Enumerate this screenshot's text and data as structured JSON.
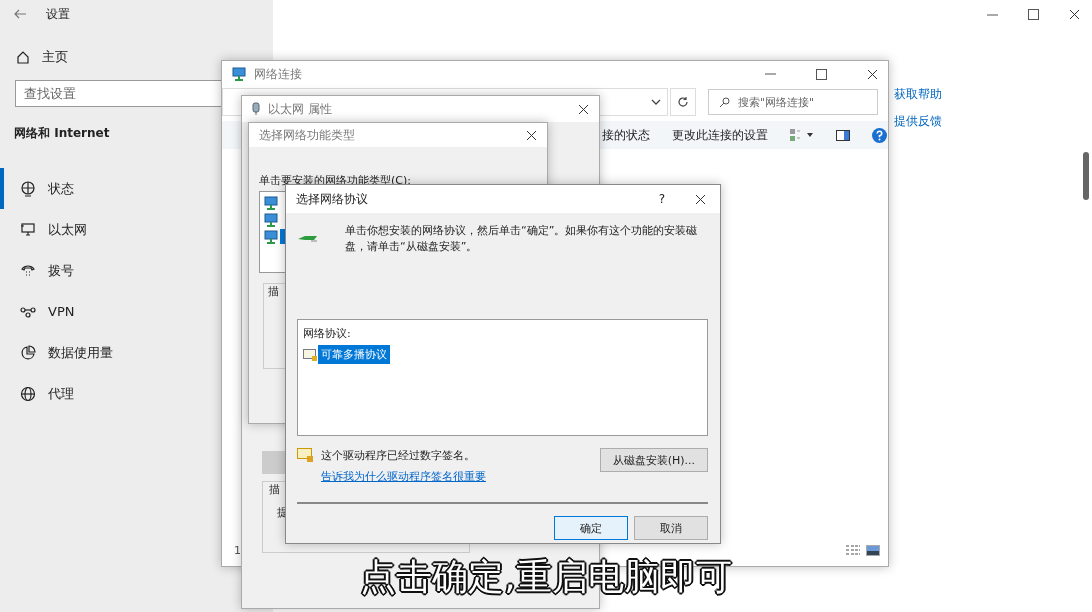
{
  "settings": {
    "title": "设置",
    "home": "主页",
    "search": {
      "placeholder": "查找设置"
    },
    "section": "网络和 Internet",
    "nav": [
      {
        "label": "状态",
        "selected": true
      },
      {
        "label": "以太网",
        "selected": false
      },
      {
        "label": "拨号",
        "selected": false
      },
      {
        "label": "VPN",
        "selected": false
      },
      {
        "label": "数据使用量",
        "selected": false
      },
      {
        "label": "代理",
        "selected": false
      }
    ],
    "links": [
      "获取帮助",
      "提供反馈"
    ]
  },
  "network_window": {
    "title": "网络连接",
    "search": {
      "placeholder": "搜索\"网络连接\""
    },
    "toolbar": [
      "接的状态",
      "更改此连接的设置"
    ],
    "status_bar": "1"
  },
  "ethernet_properties": {
    "title": "以太网 属性",
    "group_label": "描",
    "group_text": "提"
  },
  "feature_type_dialog": {
    "title": "选择网络功能类型",
    "prompt": "单击要安装的网络功能类型(C):",
    "items": [
      {
        "selected": false
      },
      {
        "selected": false
      },
      {
        "selected": true
      }
    ],
    "group_label": "描"
  },
  "protocol_dialog": {
    "title": "选择网络协议",
    "help": "?",
    "instruction": "单击你想安装的网络协议，然后单击“确定”。如果你有这个功能的安装磁盘，请单击“从磁盘安装”。",
    "list_label": "网络协议:",
    "protocols": [
      {
        "label": "可靠多播协议",
        "selected": true
      }
    ],
    "signed_note": "这个驱动程序已经过数字签名。",
    "signing_link": "告诉我为什么驱动程序签名很重要",
    "have_disk_button": "从磁盘安装(H)...",
    "buttons": [
      {
        "label": "确定",
        "focused": true
      },
      {
        "label": "取消",
        "focused": false
      }
    ]
  },
  "caption": "点击确定,重启电脑即可"
}
